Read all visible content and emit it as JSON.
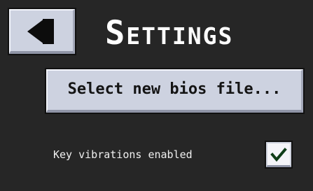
{
  "header": {
    "title": "Settings",
    "back_icon": "back-arrow-icon"
  },
  "main": {
    "bios_button_label": "Select new bios file...",
    "vibration": {
      "label": "Key vibrations enabled",
      "checked": true,
      "check_icon": "checkmark-icon"
    }
  },
  "colors": {
    "background": "#262626",
    "button_face": "#cdd2e0",
    "check_color": "#0f3d18",
    "text_light": "#ffffff"
  }
}
